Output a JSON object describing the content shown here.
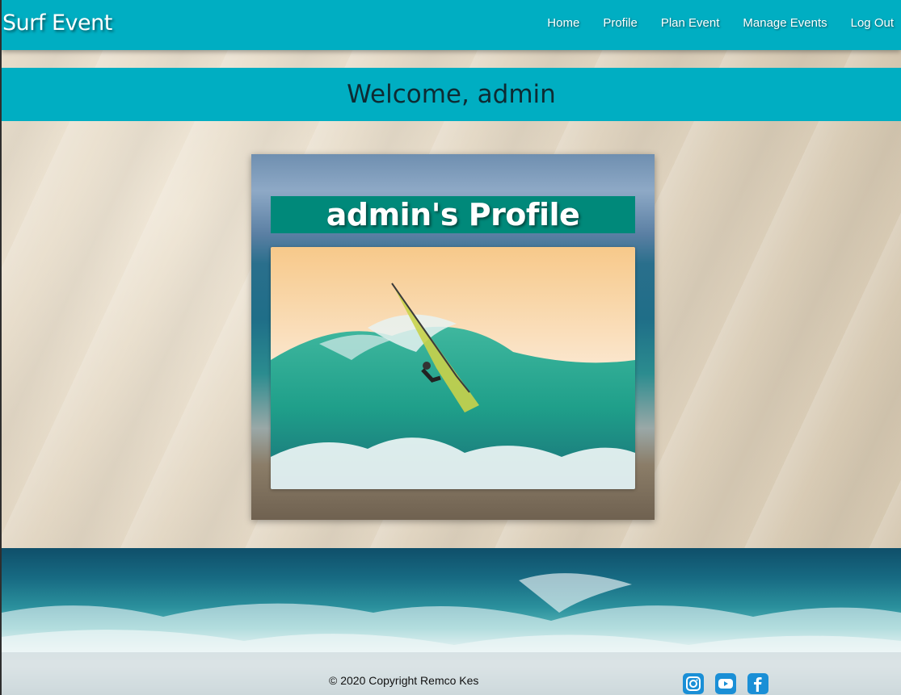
{
  "navbar": {
    "brand": "Surf Event",
    "links": [
      "Home",
      "Profile",
      "Plan Event",
      "Manage Events",
      "Log Out"
    ]
  },
  "welcome": {
    "text": "Welcome, admin"
  },
  "profile": {
    "title": "admin's Profile"
  },
  "footer": {
    "copyright": "© 2020 Copyright Remco Kes",
    "social_icons": [
      "instagram-icon",
      "youtube-icon",
      "facebook-icon"
    ]
  },
  "colors": {
    "nav_bg": "#00aec2",
    "profile_title_bg": "#00897a",
    "social_icon": "#1a8fd6"
  }
}
